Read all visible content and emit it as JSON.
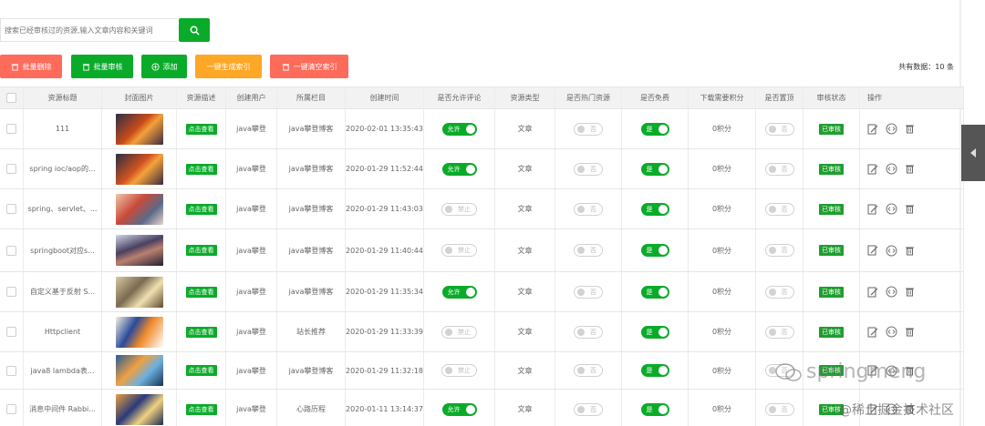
{
  "search": {
    "placeholder": "搜索已经审核过的资源,输入文章内容和关键词"
  },
  "toolbar": {
    "batch_delete": "批量删除",
    "batch_audit": "批量审核",
    "add": "添加",
    "gen_index": "一键生成索引",
    "clear_index": "一键清空索引",
    "total": "共有数据：10 条"
  },
  "colors": {
    "green": "#0bab2a",
    "red": "#ff6b5b",
    "orange": "#ffa726"
  },
  "columns": [
    "资源标题",
    "封面图片",
    "资源描述",
    "创建用户",
    "所属栏目",
    "创建时间",
    "是否允许评论",
    "资源类型",
    "是否热门资源",
    "是否免费",
    "下载需要积分",
    "是否置顶",
    "审核状态",
    "操作"
  ],
  "rows": [
    {
      "title": "111",
      "desc": "点击查看",
      "user": "java攀登",
      "column": "java攀登博客",
      "time": "2020-02-01 13:35:43",
      "comment": "允许",
      "comment_on": true,
      "type": "文章",
      "hot": "否",
      "free": "是",
      "points": "0积分",
      "top": "否",
      "status": "已审核"
    },
    {
      "title": "spring ioc/aop的...",
      "desc": "点击查看",
      "user": "java攀登",
      "column": "java攀登博客",
      "time": "2020-01-29 11:52:44",
      "comment": "允许",
      "comment_on": true,
      "type": "文章",
      "hot": "否",
      "free": "是",
      "points": "0积分",
      "top": "否",
      "status": "已审核"
    },
    {
      "title": "spring、servlet、...",
      "desc": "点击查看",
      "user": "java攀登",
      "column": "java攀登博客",
      "time": "2020-01-29 11:43:03",
      "comment": "禁止",
      "comment_on": false,
      "type": "文章",
      "hot": "否",
      "free": "是",
      "points": "0积分",
      "top": "否",
      "status": "已审核"
    },
    {
      "title": "springboot对应s...",
      "desc": "点击查看",
      "user": "java攀登",
      "column": "java攀登博客",
      "time": "2020-01-29 11:40:44",
      "comment": "禁止",
      "comment_on": false,
      "type": "文章",
      "hot": "否",
      "free": "是",
      "points": "0积分",
      "top": "否",
      "status": "已审核"
    },
    {
      "title": "自定义基于反射 S...",
      "desc": "点击查看",
      "user": "java攀登",
      "column": "java攀登博客",
      "time": "2020-01-29 11:35:34",
      "comment": "允许",
      "comment_on": true,
      "type": "文章",
      "hot": "否",
      "free": "是",
      "points": "0积分",
      "top": "否",
      "status": "已审核"
    },
    {
      "title": "Httpclient",
      "desc": "点击查看",
      "user": "java攀登",
      "column": "站长推荐",
      "time": "2020-01-29 11:33:39",
      "comment": "禁止",
      "comment_on": false,
      "type": "文章",
      "hot": "否",
      "free": "是",
      "points": "0积分",
      "top": "否",
      "status": "已审核"
    },
    {
      "title": "java8 lambda表...",
      "desc": "点击查看",
      "user": "java攀登",
      "column": "java攀登博客",
      "time": "2020-01-29 11:32:18",
      "comment": "禁止",
      "comment_on": false,
      "type": "文章",
      "hot": "否",
      "free": "是",
      "points": "0积分",
      "top": "否",
      "status": "已审核"
    },
    {
      "title": "消息中间件 Rabbi...",
      "desc": "点击查看",
      "user": "java攀登",
      "column": "心路历程",
      "time": "2020-01-11 13:14:37",
      "comment": "允许",
      "comment_on": true,
      "type": "文章",
      "hot": "否",
      "free": "是",
      "points": "0积分",
      "top": "否",
      "status": "已审核"
    }
  ],
  "watermark": {
    "name": "springmeng",
    "site": "@稀土掘金技术社区"
  }
}
